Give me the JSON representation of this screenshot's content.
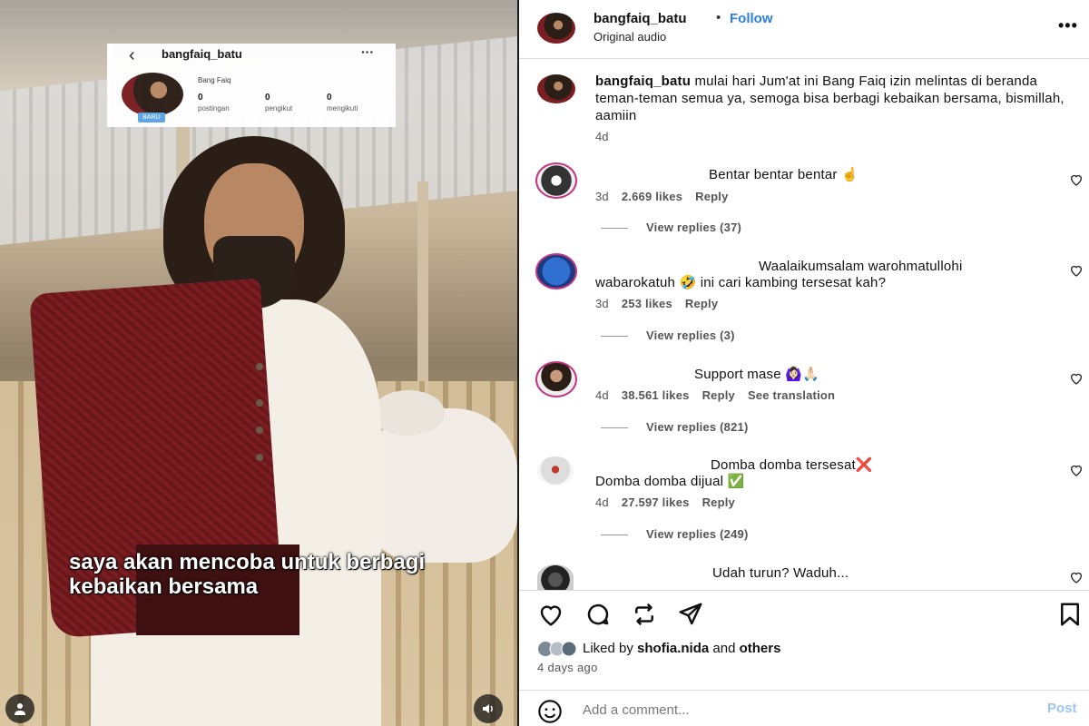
{
  "media": {
    "caption": "saya akan mencoba untuk berbagi kebaikan bersama",
    "profile_card": {
      "username": "bangfaiq_batu",
      "name": "Bang Faiq",
      "badge": "BARU",
      "stats": [
        {
          "value": "0",
          "label": "postingan"
        },
        {
          "value": "0",
          "label": "pengikut"
        },
        {
          "value": "0",
          "label": "mengikuti"
        }
      ]
    },
    "icons": {
      "user": "user-icon",
      "sound": "speaker-icon"
    }
  },
  "header": {
    "username": "bangfaiq_batu",
    "separator": "•",
    "follow_label": "Follow",
    "audio": "Original audio"
  },
  "caption": {
    "username": "bangfaiq_batu",
    "text": " mulai hari Jum'at ini Bang Faiq izin melintas di beranda teman-teman semua ya, semoga bisa berbagi kebaikan bersama, bismillah, aamiin",
    "time": "4d"
  },
  "comments": [
    {
      "text": "Bentar bentar bentar ☝️",
      "time": "3d",
      "likes": "2.669 likes",
      "reply": "Reply",
      "replies": "View replies (37)"
    },
    {
      "text_line1": "Waalaikumsalam warohmatullohi",
      "text_line2": "wabarokatuh 🤣 ini cari kambing tersesat kah?",
      "time": "3d",
      "likes": "253 likes",
      "reply": "Reply",
      "replies": "View replies (3)"
    },
    {
      "text": "Support mase 🙆🏻‍♀️🙏🏻",
      "time": "4d",
      "likes": "38.561 likes",
      "reply": "Reply",
      "translate": "See translation",
      "replies": "View replies (821)"
    },
    {
      "text_line1": "Domba domba tersesat❌",
      "text_line2": "Domba domba dijual ✅",
      "time": "4d",
      "likes": "27.597 likes",
      "reply": "Reply",
      "replies": "View replies (249)"
    },
    {
      "text": "Udah turun? Waduh..."
    }
  ],
  "likes": {
    "prefix": "Liked by ",
    "user": "shofia.nida",
    "mid": " and ",
    "others": "others",
    "ago": "4 days ago"
  },
  "composer": {
    "placeholder": "Add a comment...",
    "post_label": "Post"
  },
  "colors": {
    "follow": "#2b7de9",
    "post": "#9cc4f5"
  }
}
